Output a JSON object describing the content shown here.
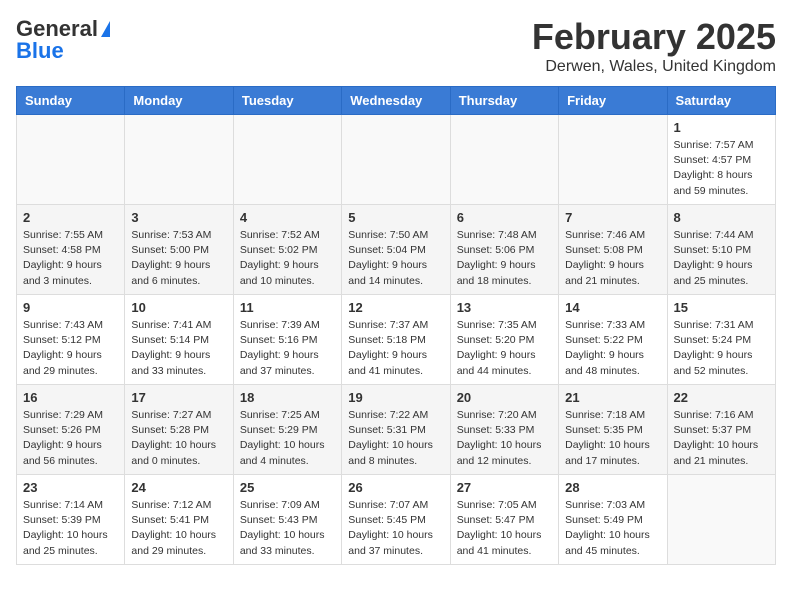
{
  "logo": {
    "general": "General",
    "blue": "Blue"
  },
  "title": "February 2025",
  "location": "Derwen, Wales, United Kingdom",
  "weekdays": [
    "Sunday",
    "Monday",
    "Tuesday",
    "Wednesday",
    "Thursday",
    "Friday",
    "Saturday"
  ],
  "weeks": [
    [
      {
        "day": "",
        "info": ""
      },
      {
        "day": "",
        "info": ""
      },
      {
        "day": "",
        "info": ""
      },
      {
        "day": "",
        "info": ""
      },
      {
        "day": "",
        "info": ""
      },
      {
        "day": "",
        "info": ""
      },
      {
        "day": "1",
        "info": "Sunrise: 7:57 AM\nSunset: 4:57 PM\nDaylight: 8 hours and 59 minutes."
      }
    ],
    [
      {
        "day": "2",
        "info": "Sunrise: 7:55 AM\nSunset: 4:58 PM\nDaylight: 9 hours and 3 minutes."
      },
      {
        "day": "3",
        "info": "Sunrise: 7:53 AM\nSunset: 5:00 PM\nDaylight: 9 hours and 6 minutes."
      },
      {
        "day": "4",
        "info": "Sunrise: 7:52 AM\nSunset: 5:02 PM\nDaylight: 9 hours and 10 minutes."
      },
      {
        "day": "5",
        "info": "Sunrise: 7:50 AM\nSunset: 5:04 PM\nDaylight: 9 hours and 14 minutes."
      },
      {
        "day": "6",
        "info": "Sunrise: 7:48 AM\nSunset: 5:06 PM\nDaylight: 9 hours and 18 minutes."
      },
      {
        "day": "7",
        "info": "Sunrise: 7:46 AM\nSunset: 5:08 PM\nDaylight: 9 hours and 21 minutes."
      },
      {
        "day": "8",
        "info": "Sunrise: 7:44 AM\nSunset: 5:10 PM\nDaylight: 9 hours and 25 minutes."
      }
    ],
    [
      {
        "day": "9",
        "info": "Sunrise: 7:43 AM\nSunset: 5:12 PM\nDaylight: 9 hours and 29 minutes."
      },
      {
        "day": "10",
        "info": "Sunrise: 7:41 AM\nSunset: 5:14 PM\nDaylight: 9 hours and 33 minutes."
      },
      {
        "day": "11",
        "info": "Sunrise: 7:39 AM\nSunset: 5:16 PM\nDaylight: 9 hours and 37 minutes."
      },
      {
        "day": "12",
        "info": "Sunrise: 7:37 AM\nSunset: 5:18 PM\nDaylight: 9 hours and 41 minutes."
      },
      {
        "day": "13",
        "info": "Sunrise: 7:35 AM\nSunset: 5:20 PM\nDaylight: 9 hours and 44 minutes."
      },
      {
        "day": "14",
        "info": "Sunrise: 7:33 AM\nSunset: 5:22 PM\nDaylight: 9 hours and 48 minutes."
      },
      {
        "day": "15",
        "info": "Sunrise: 7:31 AM\nSunset: 5:24 PM\nDaylight: 9 hours and 52 minutes."
      }
    ],
    [
      {
        "day": "16",
        "info": "Sunrise: 7:29 AM\nSunset: 5:26 PM\nDaylight: 9 hours and 56 minutes."
      },
      {
        "day": "17",
        "info": "Sunrise: 7:27 AM\nSunset: 5:28 PM\nDaylight: 10 hours and 0 minutes."
      },
      {
        "day": "18",
        "info": "Sunrise: 7:25 AM\nSunset: 5:29 PM\nDaylight: 10 hours and 4 minutes."
      },
      {
        "day": "19",
        "info": "Sunrise: 7:22 AM\nSunset: 5:31 PM\nDaylight: 10 hours and 8 minutes."
      },
      {
        "day": "20",
        "info": "Sunrise: 7:20 AM\nSunset: 5:33 PM\nDaylight: 10 hours and 12 minutes."
      },
      {
        "day": "21",
        "info": "Sunrise: 7:18 AM\nSunset: 5:35 PM\nDaylight: 10 hours and 17 minutes."
      },
      {
        "day": "22",
        "info": "Sunrise: 7:16 AM\nSunset: 5:37 PM\nDaylight: 10 hours and 21 minutes."
      }
    ],
    [
      {
        "day": "23",
        "info": "Sunrise: 7:14 AM\nSunset: 5:39 PM\nDaylight: 10 hours and 25 minutes."
      },
      {
        "day": "24",
        "info": "Sunrise: 7:12 AM\nSunset: 5:41 PM\nDaylight: 10 hours and 29 minutes."
      },
      {
        "day": "25",
        "info": "Sunrise: 7:09 AM\nSunset: 5:43 PM\nDaylight: 10 hours and 33 minutes."
      },
      {
        "day": "26",
        "info": "Sunrise: 7:07 AM\nSunset: 5:45 PM\nDaylight: 10 hours and 37 minutes."
      },
      {
        "day": "27",
        "info": "Sunrise: 7:05 AM\nSunset: 5:47 PM\nDaylight: 10 hours and 41 minutes."
      },
      {
        "day": "28",
        "info": "Sunrise: 7:03 AM\nSunset: 5:49 PM\nDaylight: 10 hours and 45 minutes."
      },
      {
        "day": "",
        "info": ""
      }
    ]
  ]
}
